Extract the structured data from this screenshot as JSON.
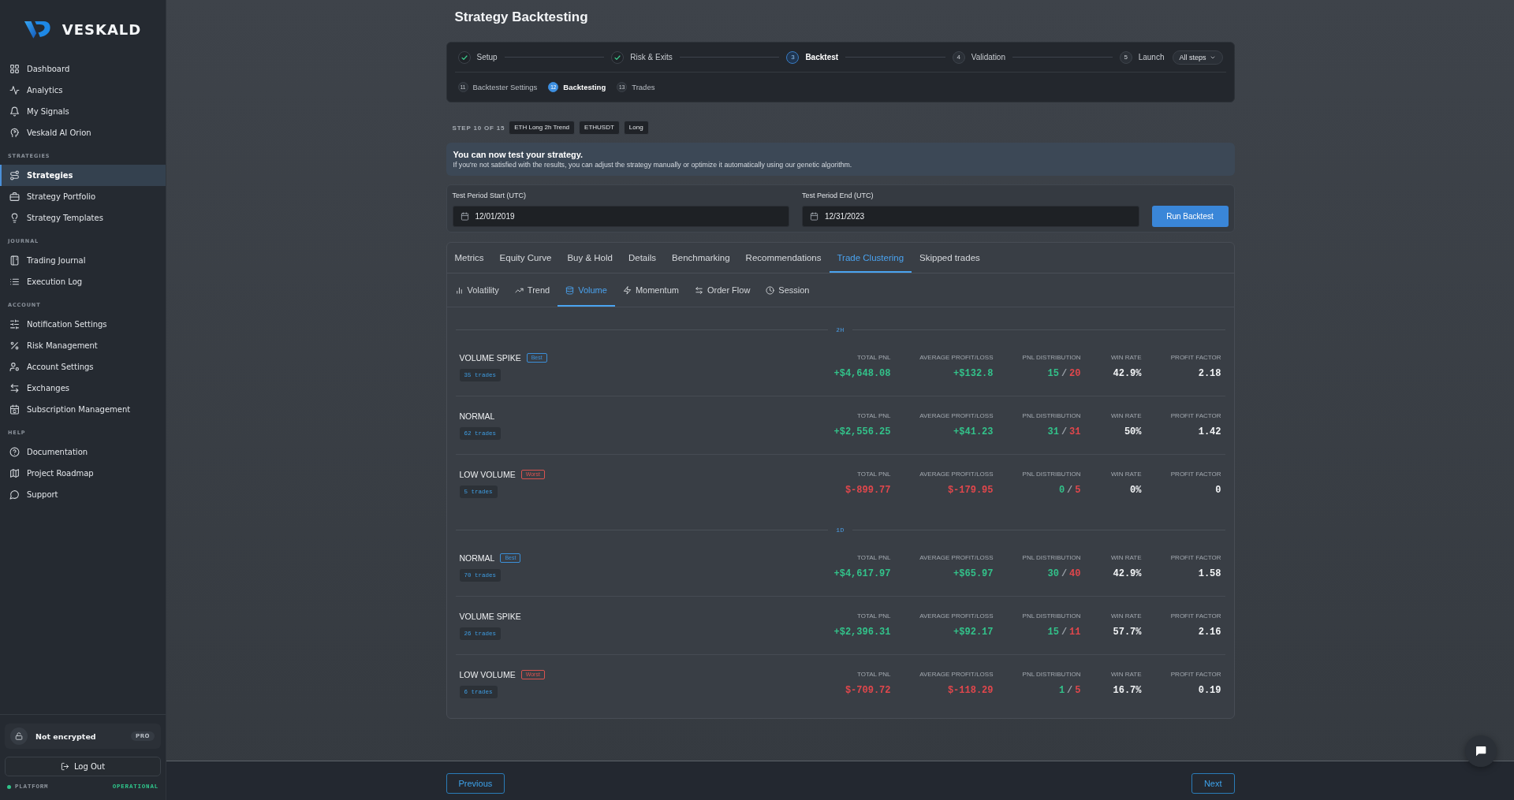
{
  "sidebar": {
    "brand": "VESKALD",
    "sections": [
      {
        "items": [
          {
            "label": "Dashboard",
            "selected": false
          },
          {
            "label": "Analytics",
            "selected": false
          },
          {
            "label": "My Signals",
            "selected": false
          },
          {
            "label": "Veskald AI Orion",
            "selected": false
          }
        ]
      },
      {
        "title": "STRATEGIES",
        "items": [
          {
            "label": "Strategies",
            "selected": true
          },
          {
            "label": "Strategy Portfolio",
            "selected": false
          },
          {
            "label": "Strategy Templates",
            "selected": false
          }
        ]
      },
      {
        "title": "JOURNAL",
        "items": [
          {
            "label": "Trading Journal",
            "selected": false
          },
          {
            "label": "Execution Log",
            "selected": false
          }
        ]
      },
      {
        "title": "ACCOUNT",
        "items": [
          {
            "label": "Notification Settings",
            "selected": false
          },
          {
            "label": "Risk Management",
            "selected": false
          },
          {
            "label": "Account Settings",
            "selected": false
          },
          {
            "label": "Exchanges",
            "selected": false
          },
          {
            "label": "Subscription Management",
            "selected": false
          }
        ]
      },
      {
        "title": "HELP",
        "items": [
          {
            "label": "Documentation",
            "selected": false
          },
          {
            "label": "Project Roadmap",
            "selected": false
          },
          {
            "label": "Support",
            "selected": false
          }
        ]
      }
    ],
    "encryption": {
      "label": "Not encrypted",
      "plan": "PRO"
    },
    "logout": "Log Out",
    "status": {
      "label": "PLATFORM",
      "value": "OPERATIONAL"
    }
  },
  "header": {
    "title": "Strategy Backtesting"
  },
  "stepper": {
    "steps": [
      {
        "label": "Setup",
        "done": true,
        "current": false
      },
      {
        "label": "Risk & Exits",
        "done": true,
        "current": false
      },
      {
        "number": "3",
        "label": "Backtest",
        "done": false,
        "current": true
      },
      {
        "number": "4",
        "label": "Validation",
        "done": false,
        "current": false
      },
      {
        "number": "5",
        "label": "Launch",
        "done": false,
        "current": false
      }
    ],
    "all_steps": "All steps",
    "substeps": [
      {
        "number": "11",
        "label": "Backtester Settings",
        "selected": false
      },
      {
        "number": "12",
        "label": "Backtesting",
        "selected": true
      },
      {
        "number": "13",
        "label": "Trades",
        "selected": false
      }
    ]
  },
  "progress": {
    "label": "STEP 10 OF 15",
    "tags": [
      "ETH Long 2h Trend",
      "ETHUSDT",
      "Long"
    ]
  },
  "notice": {
    "title": "You can now test your strategy.",
    "text": "If you're not satisfied with the results, you can adjust the strategy manually or optimize it automatically using our genetic algorithm."
  },
  "test_period": {
    "fields": [
      {
        "label": "Test Period Start (UTC)",
        "value": "12/01/2019"
      },
      {
        "label": "Test Period End (UTC)",
        "value": "12/31/2023"
      }
    ],
    "run_button": "Run Backtest"
  },
  "results": {
    "tabs": [
      {
        "label": "Metrics",
        "selected": false
      },
      {
        "label": "Equity Curve",
        "selected": false
      },
      {
        "label": "Buy & Hold",
        "selected": false
      },
      {
        "label": "Details",
        "selected": false
      },
      {
        "label": "Benchmarking",
        "selected": false
      },
      {
        "label": "Recommendations",
        "selected": false
      },
      {
        "label": "Trade Clustering",
        "selected": true
      },
      {
        "label": "Skipped trades",
        "selected": false
      }
    ],
    "subtabs": [
      {
        "label": "Volatility",
        "selected": false
      },
      {
        "label": "Trend",
        "selected": false
      },
      {
        "label": "Volume",
        "selected": true
      },
      {
        "label": "Momentum",
        "selected": false
      },
      {
        "label": "Order Flow",
        "selected": false
      },
      {
        "label": "Session",
        "selected": false
      }
    ],
    "groups": [
      {
        "label": "2H",
        "rows": [
          {
            "name": "VOLUME SPIKE",
            "badge": {
              "label": "Best",
              "kind": "best"
            },
            "trades": "35 trades",
            "metrics": [
              {
                "kind": "value",
                "label": "TOTAL PNL",
                "value": "+$4,648.08",
                "color": "#33c28a"
              },
              {
                "kind": "value",
                "label": "AVERAGE PROFIT/LOSS",
                "value": "+$132.8",
                "color": "#33c28a"
              },
              {
                "kind": "split",
                "label": "PNL DISTRIBUTION",
                "wins": "15",
                "separator": "/",
                "losses": "20"
              },
              {
                "kind": "value",
                "label": "WIN RATE",
                "value": "42.9%",
                "color": "#f2f4f6"
              },
              {
                "kind": "value",
                "label": "PROFIT FACTOR",
                "value": "2.18",
                "color": "#f2f4f6"
              }
            ]
          },
          {
            "name": "NORMAL",
            "trades": "62 trades",
            "metrics": [
              {
                "kind": "value",
                "label": "TOTAL PNL",
                "value": "+$2,556.25",
                "color": "#33c28a"
              },
              {
                "kind": "value",
                "label": "AVERAGE PROFIT/LOSS",
                "value": "+$41.23",
                "color": "#33c28a"
              },
              {
                "kind": "split",
                "label": "PNL DISTRIBUTION",
                "wins": "31",
                "separator": "/",
                "losses": "31"
              },
              {
                "kind": "value",
                "label": "WIN RATE",
                "value": "50%",
                "color": "#f2f4f6"
              },
              {
                "kind": "value",
                "label": "PROFIT FACTOR",
                "value": "1.42",
                "color": "#f2f4f6"
              }
            ]
          },
          {
            "name": "LOW VOLUME",
            "badge": {
              "label": "Worst",
              "kind": "worst"
            },
            "trades": "5 trades",
            "metrics": [
              {
                "kind": "value",
                "label": "TOTAL PNL",
                "value": "$-899.77",
                "color": "#e1474c"
              },
              {
                "kind": "value",
                "label": "AVERAGE PROFIT/LOSS",
                "value": "$-179.95",
                "color": "#e1474c"
              },
              {
                "kind": "split",
                "label": "PNL DISTRIBUTION",
                "wins": "0",
                "separator": "/",
                "losses": "5"
              },
              {
                "kind": "value",
                "label": "WIN RATE",
                "value": "0%",
                "color": "#f2f4f6"
              },
              {
                "kind": "value",
                "label": "PROFIT FACTOR",
                "value": "0",
                "color": "#f2f4f6"
              }
            ]
          }
        ]
      },
      {
        "label": "1D",
        "rows": [
          {
            "name": "NORMAL",
            "badge": {
              "label": "Best",
              "kind": "best"
            },
            "trades": "70 trades",
            "metrics": [
              {
                "kind": "value",
                "label": "TOTAL PNL",
                "value": "+$4,617.97",
                "color": "#33c28a"
              },
              {
                "kind": "value",
                "label": "AVERAGE PROFIT/LOSS",
                "value": "+$65.97",
                "color": "#33c28a"
              },
              {
                "kind": "split",
                "label": "PNL DISTRIBUTION",
                "wins": "30",
                "separator": "/",
                "losses": "40"
              },
              {
                "kind": "value",
                "label": "WIN RATE",
                "value": "42.9%",
                "color": "#f2f4f6"
              },
              {
                "kind": "value",
                "label": "PROFIT FACTOR",
                "value": "1.58",
                "color": "#f2f4f6"
              }
            ]
          },
          {
            "name": "VOLUME SPIKE",
            "trades": "26 trades",
            "metrics": [
              {
                "kind": "value",
                "label": "TOTAL PNL",
                "value": "+$2,396.31",
                "color": "#33c28a"
              },
              {
                "kind": "value",
                "label": "AVERAGE PROFIT/LOSS",
                "value": "+$92.17",
                "color": "#33c28a"
              },
              {
                "kind": "split",
                "label": "PNL DISTRIBUTION",
                "wins": "15",
                "separator": "/",
                "losses": "11"
              },
              {
                "kind": "value",
                "label": "WIN RATE",
                "value": "57.7%",
                "color": "#f2f4f6"
              },
              {
                "kind": "value",
                "label": "PROFIT FACTOR",
                "value": "2.16",
                "color": "#f2f4f6"
              }
            ]
          },
          {
            "name": "LOW VOLUME",
            "badge": {
              "label": "Worst",
              "kind": "worst"
            },
            "trades": "6 trades",
            "metrics": [
              {
                "kind": "value",
                "label": "TOTAL PNL",
                "value": "$-709.72",
                "color": "#e1474c"
              },
              {
                "kind": "value",
                "label": "AVERAGE PROFIT/LOSS",
                "value": "$-118.29",
                "color": "#e1474c"
              },
              {
                "kind": "split",
                "label": "PNL DISTRIBUTION",
                "wins": "1",
                "separator": "/",
                "losses": "5"
              },
              {
                "kind": "value",
                "label": "WIN RATE",
                "value": "16.7%",
                "color": "#f2f4f6"
              },
              {
                "kind": "value",
                "label": "PROFIT FACTOR",
                "value": "0.19",
                "color": "#f2f4f6"
              }
            ]
          }
        ]
      }
    ]
  },
  "footer": {
    "previous": "Previous",
    "next": "Next"
  }
}
